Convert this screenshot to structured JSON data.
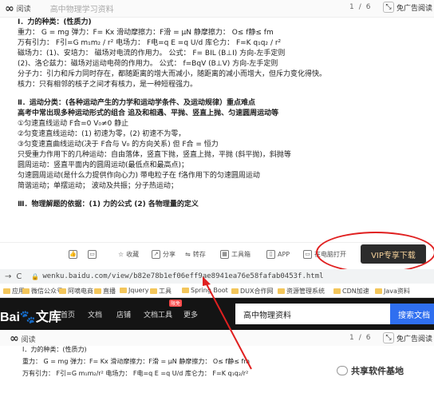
{
  "doc_header": {
    "logo_label": "阅读",
    "title": "高中物理学习资料",
    "page": "1",
    "page_sep": "/",
    "page_total": "6",
    "adfree_label": "免广告阅读"
  },
  "doc_lines": [
    {
      "text": "Ⅰ．力的种类：(性质力)",
      "bold": true
    },
    {
      "text": "重力：  G = mg        弹力：F= Kx        滑动摩擦力：F滑 = μN        静摩擦力：   O≤ f静≤ fm",
      "bold": false
    },
    {
      "text": "万有引力： F引=G m₁m₂ / r²        电场力：  F电=q E =q U/d        库仑力：   F=K q₁q₂ / r²",
      "bold": false
    },
    {
      "text": "磁场力：(1)、安培力：  磁场对电流的作用力。      公式： F= BIL    (B⊥I)      方向-左手定则",
      "bold": false
    },
    {
      "text": "        (2)、洛仑兹力：磁场对运动电荷的作用力。    公式：  f=BqV   (B⊥V)      方向-左手定则",
      "bold": false
    },
    {
      "text": "分子力：引力和斥力同时存在，都随距离的增大而减小，随距离的减小而增大，但斥力变化得快。",
      "bold": false
    },
    {
      "text": "核力：只有相邻的核子之间才有核力，是一种短程强力。",
      "bold": false
    },
    {
      "text": "",
      "bold": false
    },
    {
      "text": "Ⅱ．运动分类：(各种运动产生的力学和运动学条件、及运动规律）重点难点",
      "bold": true
    },
    {
      "text": "高考中常出现多种运动形式的组合   追及和相遇、平抛、竖直上抛、匀速圆周运动等",
      "bold": true
    },
    {
      "text": "①匀速直线运动        F合=0   V₀≠0   静止",
      "bold": false
    },
    {
      "text": "②匀变速直线运动：(1) 初速为零，(2) 初速不为零，",
      "bold": false
    },
    {
      "text": "③匀变速直曲线运动(决于 F合与 V₀ 的方向关系)  但 F合 = 恒力",
      "bold": false
    },
    {
      "text": "只受重力作用下的几种运动：自由落体，竖直下抛，竖直上抛，平抛 (斜平抛)，斜抛等",
      "bold": false
    },
    {
      "text": "圆周运动：竖直平面内的圆周运动(最低点和最高点)；",
      "bold": false
    },
    {
      "text": "匀速圆周运动(是什么力提供作向心力)  带电粒子在 f洛作用下的匀速圆周运动",
      "bold": false
    },
    {
      "text": "简谐运动；单摆运动；  波动及共振；分子热运动；",
      "bold": false
    },
    {
      "text": "",
      "bold": false
    },
    {
      "text": "Ⅲ．物理解题的依据：(1) 力的公式              (2)  各物理量的定义",
      "bold": true
    }
  ],
  "toolbar": {
    "like": "",
    "comment": "",
    "collect": "收藏",
    "share": "分享",
    "transfer": "转存",
    "tools": "工具箱",
    "app": "APP",
    "computer_open": "在电脑打开",
    "vip_button": "VIP专享下载"
  },
  "address_bar": {
    "url": "wenku.baidu.com/view/b82e78b1ef06eff9ae8941ea76e58fafab0453f.html"
  },
  "bookmarks": [
    "应用",
    "微信公众号",
    "阿嘀电商",
    "直播",
    "Jquery",
    "工具",
    "Spring Boot",
    "DUX合作网",
    "资源管理系统",
    "CDN加速",
    "Java资料"
  ],
  "baidu_nav": {
    "logo_text": "Bai",
    "logo_suffix": "文库",
    "links": [
      "首页",
      "文档",
      "店铺",
      "文档工具",
      "更多"
    ],
    "new_badge": "限免",
    "search_value": "高中物理资料",
    "search_button": "搜索文档"
  },
  "doc2_lines": [
    "Ⅰ．力的种类：(性质力)",
    "重力：  G = mg        弹力：F= Kx        滑动摩擦力：F滑 = μN        静摩擦力：   O≤ f静≤ fm",
    "万有引力： F引=G m₁m₂/r²        电场力：  F电=q E =q U/d        库仑力：   F=K q₁q₂/r²"
  ],
  "watermark": "共享软件基地",
  "colors": {
    "vip_bg": "#2c2c2c",
    "vip_text": "#f5d29b",
    "ellipse": "#e02020",
    "arrow": "#e02020",
    "baidu_blue": "#2f6ff0"
  }
}
